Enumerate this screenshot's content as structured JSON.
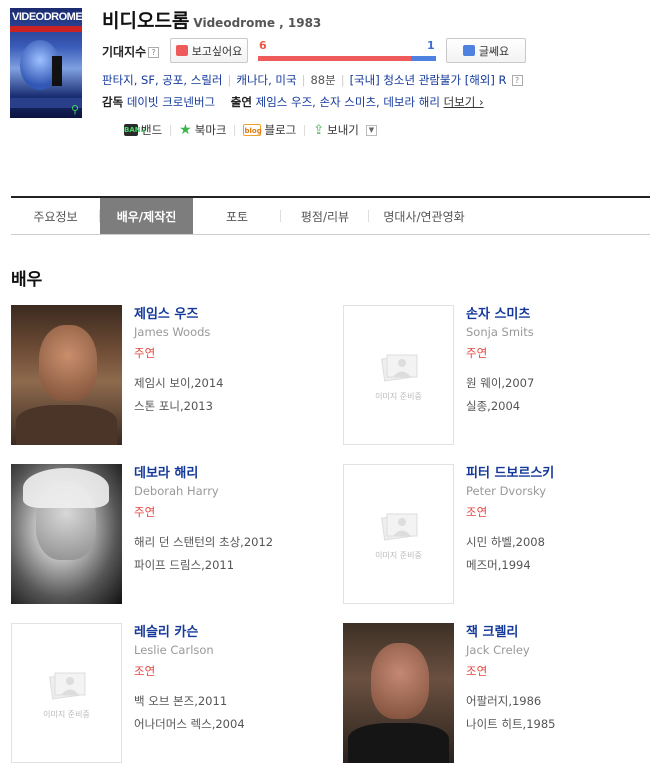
{
  "movie": {
    "poster_title": "VIDEODROME",
    "title_ko": "비디오드롬",
    "title_en_year": "Videodrome , 1983",
    "expect_label": "기대지수",
    "help": "?",
    "want_label": "보고싶어요",
    "nah_label": "글쎄요",
    "want_count": "6",
    "nah_count": "1",
    "want_ratio": 0.857,
    "genres": "판타지, SF, 공포, 스릴러",
    "country": "캐나다, 미국",
    "runtime": "88분",
    "rating": "[국내] 청소년 관람불가 [해외] R",
    "director_label": "감독",
    "director": "데이빗 크로넨버그",
    "cast_label": "출연",
    "cast": "제임스 우즈, 손자 스미츠, 데보라 해리",
    "more_label": "더보기 ›"
  },
  "share": {
    "band": "밴드",
    "bookmark": "북마크",
    "blog": "블로그",
    "send": "보내기"
  },
  "tabs": [
    "주요정보",
    "배우/제작진",
    "포토",
    "평점/리뷰",
    "명대사/연관영화"
  ],
  "active_tab": 1,
  "section_title": "배우",
  "no_image_text": "이미지 준비중",
  "actors": [
    {
      "name": "제임스 우즈",
      "en": "James Woods",
      "role": "주연",
      "work1": "제임시 보이,2014",
      "work2": "스톤 포니,2013",
      "photo": "portrait"
    },
    {
      "name": "손자 스미츠",
      "en": "Sonja Smits",
      "role": "주연",
      "work1": "원 웨이,2007",
      "work2": "실종,2004",
      "photo": "none"
    },
    {
      "name": "데보라 해리",
      "en": "Deborah Harry",
      "role": "주연",
      "work1": "해리 던 스탠턴의 초상,2012",
      "work2": "파이프 드림스,2011",
      "photo": "portrait-bw"
    },
    {
      "name": "피터 드보르스키",
      "en": "Peter Dvorsky",
      "role": "조연",
      "work1": "시민 하벨,2008",
      "work2": "메즈머,1994",
      "photo": "none"
    },
    {
      "name": "레슬리 카슨",
      "en": "Leslie Carlson",
      "role": "조연",
      "work1": "백 오브 본즈,2011",
      "work2": "어나더머스 렉스,2004",
      "photo": "none"
    },
    {
      "name": "잭 크렐리",
      "en": "Jack Creley",
      "role": "조연",
      "work1": "어팔러지,1986",
      "work2": "나이트 히트,1985",
      "photo": "portrait"
    }
  ],
  "colors": {
    "link": "#14399a",
    "role": "#e4463f",
    "want": "#ef5a5a",
    "nah": "#4f82e0",
    "tab_active": "#7d7d7d"
  }
}
